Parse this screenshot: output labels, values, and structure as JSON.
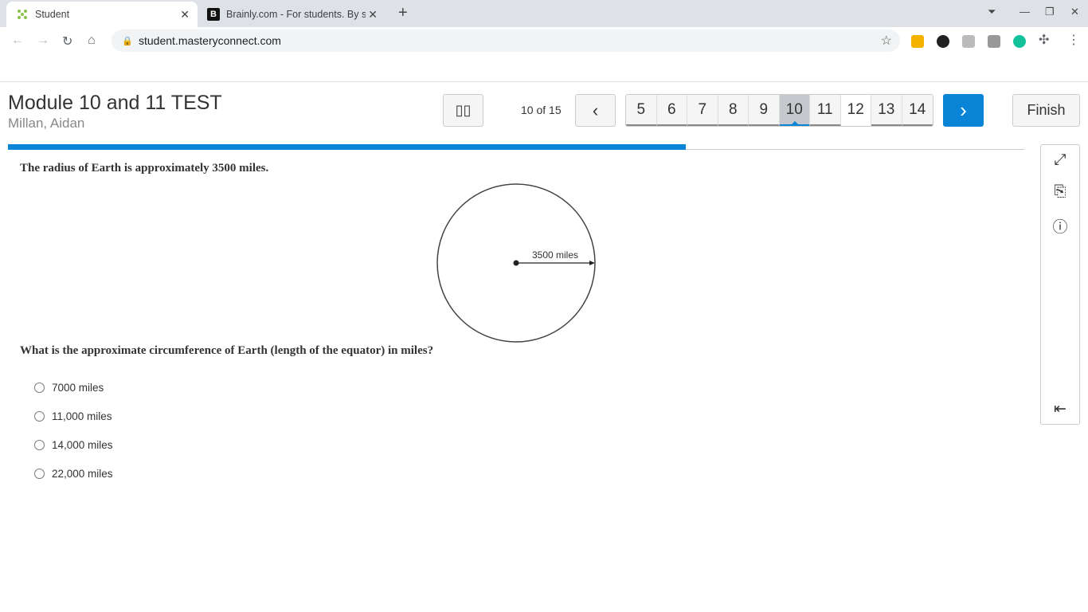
{
  "browser": {
    "tabs": [
      {
        "title": "Student",
        "active": true
      },
      {
        "title": "Brainly.com - For students. By st",
        "active": false
      }
    ],
    "url": "student.masteryconnect.com"
  },
  "header": {
    "title": "Module 10 and 11 TEST",
    "student": "Millan, Aidan",
    "counter": "10 of 15",
    "finish": "Finish",
    "questions": [
      "5",
      "6",
      "7",
      "8",
      "9",
      "10",
      "11",
      "12",
      "13",
      "14"
    ],
    "current": "10",
    "progress_percent": 66.7
  },
  "question": {
    "intro": "The radius of Earth is approximately 3500 miles.",
    "diagram_label": "3500 miles",
    "prompt": "What is the approximate circumference of Earth (length of the equator) in miles?",
    "options": [
      "7000 miles",
      "11,000 miles",
      "14,000 miles",
      "22,000 miles"
    ]
  },
  "colors": {
    "accent": "#0a84d6"
  }
}
